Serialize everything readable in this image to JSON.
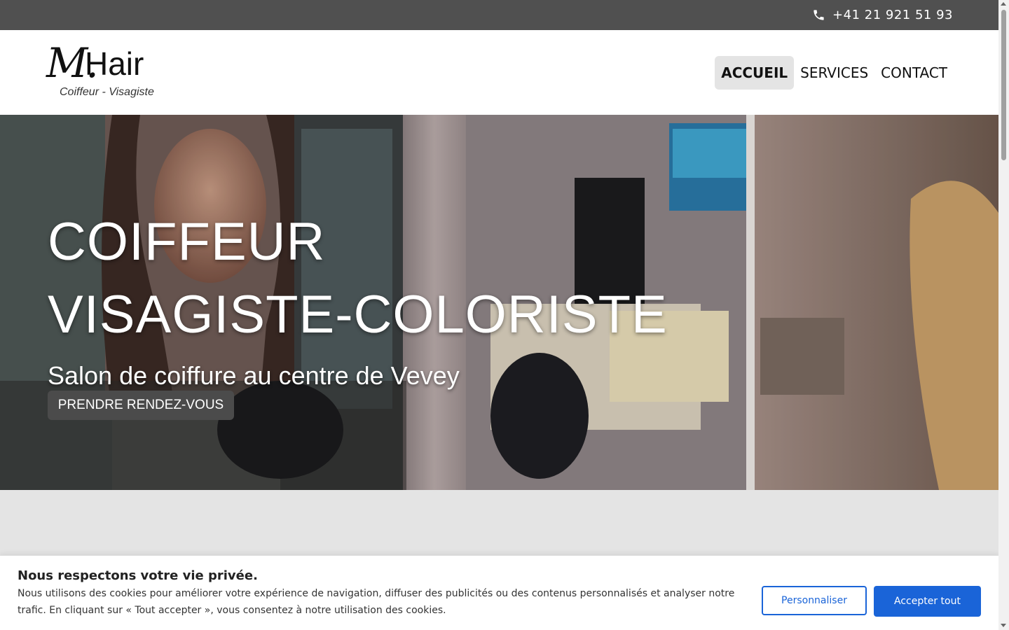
{
  "topbar": {
    "phone": "+41 21 921 51 93",
    "phone_icon": "phone-icon"
  },
  "logo": {
    "mark": "M.",
    "name": "Hair",
    "tagline": "Coiffeur - Visagiste"
  },
  "nav": {
    "items": [
      {
        "label": "ACCUEIL",
        "active": true
      },
      {
        "label": "SERVICES"
      },
      {
        "label": "CONTACT"
      }
    ]
  },
  "hero": {
    "title_line1": "COIFFEUR",
    "title_line2": "VISAGISTE-COLORISTE",
    "subtitle": "Salon de coiffure au centre de Vevey",
    "cta": "PRENDRE RENDEZ-VOUS"
  },
  "cookie": {
    "title": "Nous respectons votre vie privée.",
    "text": "Nous utilisons des cookies pour améliorer votre expérience de navigation, diffuser des publicités ou des contenus personnalisés et analyser notre trafic. En cliquant sur « Tout accepter », vous consentez à notre utilisation des cookies.",
    "customize": "Personnaliser",
    "accept": "Accepter tout"
  },
  "colors": {
    "topbar": "#505050",
    "primary_button": "#1a64d8",
    "cta": "#4b4b4b",
    "active_nav": "#e4e4e4"
  }
}
